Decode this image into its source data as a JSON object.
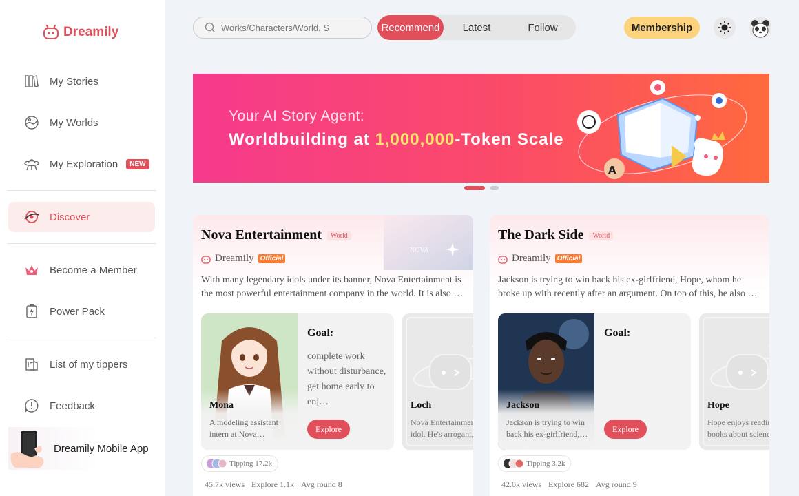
{
  "app": {
    "name": "Dreamily"
  },
  "sidebar": {
    "items": [
      {
        "label": "My Stories",
        "icon": "books-icon"
      },
      {
        "label": "My Worlds",
        "icon": "globe-icon"
      },
      {
        "label": "My Exploration",
        "icon": "ufo-icon",
        "badge": "NEW"
      },
      {
        "label": "Discover",
        "icon": "discover-icon",
        "active": true
      },
      {
        "label": "Become a Member",
        "icon": "crown-icon"
      },
      {
        "label": "Power Pack",
        "icon": "battery-icon"
      },
      {
        "label": "List of my tippers",
        "icon": "tippers-icon"
      },
      {
        "label": "Feedback",
        "icon": "feedback-icon"
      }
    ],
    "promo_label": "Dreamily Mobile App"
  },
  "topbar": {
    "search_placeholder": "Works/Characters/World, S",
    "tabs": [
      "Recommend",
      "Latest",
      "Follow"
    ],
    "active_tab": "Recommend",
    "membership_label": "Membership"
  },
  "banner": {
    "line1": "Your AI Story Agent:",
    "line2_prefix": "Worldbuilding at ",
    "line2_highlight": "1,000,000",
    "line2_suffix": "-Token Scale",
    "slide_count": 2,
    "active_slide": 1
  },
  "cards": [
    {
      "title": "Nova Entertainment",
      "tag": "World",
      "author": "Dreamily",
      "official": "Official",
      "desc": "With many legendary idols under its banner, Nova Entertainment is the most powerful entertainment company in the world. It is also …",
      "main_char": {
        "name": "Mona",
        "desc": "A modeling assistant intern at Nova…",
        "goal_label": "Goal:",
        "goal": "complete work without disturbance, get home early to enj…",
        "explore": "Explore"
      },
      "side_char": {
        "name": "Loch",
        "desc": "Nova Entertainment idol. He's arrogant,"
      },
      "tipping": "Tipping 17.2k",
      "views": "45.7k views",
      "explore_count": "Explore 1.1k",
      "avg_round": "Avg round 8"
    },
    {
      "title": "The Dark Side",
      "tag": "World",
      "author": "Dreamily",
      "official": "Official",
      "desc": "Jackson is trying to win back his ex-girlfriend, Hope, whom he broke up with recently after an argument. On top of this, he also …",
      "main_char": {
        "name": "Jackson",
        "desc": "Jackson is trying to win back his ex-girlfriend,…",
        "goal_label": "Goal:",
        "goal": "",
        "explore": "Explore"
      },
      "side_char": {
        "name": "Hope",
        "desc": "Hope enjoys reading books about science"
      },
      "tipping": "Tipping 3.2k",
      "views": "42.0k views",
      "explore_count": "Explore 682",
      "avg_round": "Avg round 9"
    }
  ],
  "colors": {
    "accent": "#e14f5b",
    "membership": "#fcd27c",
    "banner_start": "#f53a8c",
    "banner_end": "#ff6a3d"
  }
}
